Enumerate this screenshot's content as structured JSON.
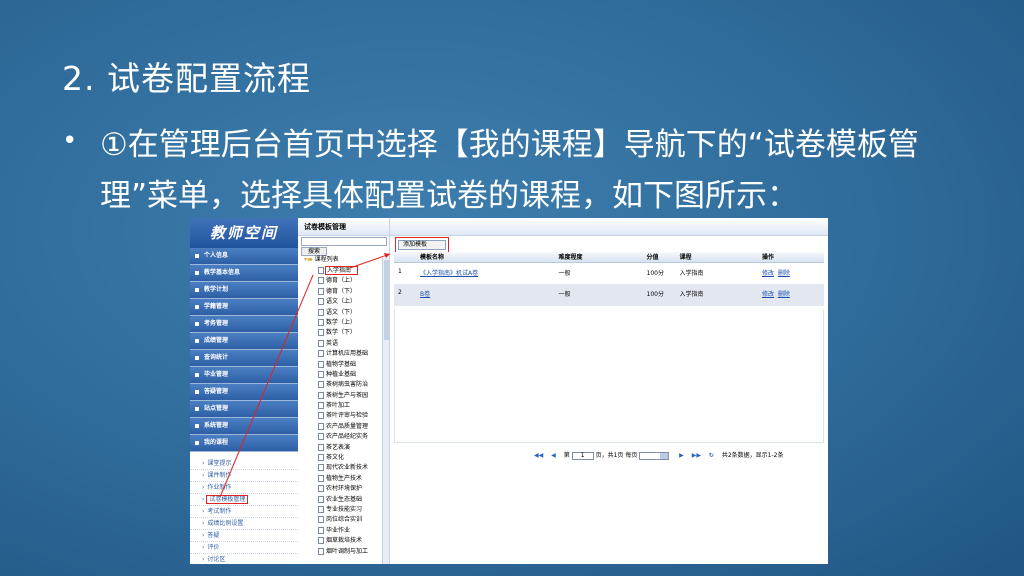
{
  "slide": {
    "title": "2. 试卷配置流程",
    "bullet": "①在管理后台首页中选择【我的课程】导航下的“试卷模板管理”菜单，选择具体配置试卷的课程，如下图所示："
  },
  "app": {
    "logo": "教师空间",
    "menu": [
      "个人信息",
      "教学基本信息",
      "教学计划",
      "学籍管理",
      "考务管理",
      "成绩管理",
      "查询统计",
      "毕业管理",
      "答疑管理",
      "站点管理",
      "系统管理",
      "我的课程"
    ],
    "sub_menu": [
      "课堂提示",
      "课件制作",
      "作业制作",
      "试卷模板管理",
      "考试制作",
      "成绩比例设置",
      "答疑",
      "评价",
      "讨论区"
    ],
    "sub_menu_active": "试卷模板管理",
    "panel_title": "试卷模板管理",
    "search_button": "搜索",
    "tree_root": "课程列表",
    "courses": [
      "入学指南",
      "德育（上）",
      "德育（下）",
      "语文（上）",
      "语文（下）",
      "数学（上）",
      "数学（下）",
      "英语",
      "计算机应用基础",
      "植物学基础",
      "种植业基础",
      "茶树病虫害防治",
      "茶树生产与茶园",
      "茶叶加工",
      "茶叶评审与检验",
      "农产品质量管理",
      "农产品经纪实务",
      "茶艺表演",
      "茶文化",
      "现代农业新技术",
      "植物生产技术",
      "农村环境保护",
      "农业生态基础",
      "专业技能实习",
      "岗位综合实训",
      "毕业作业",
      "烟草栽培技术",
      "烟叶调制与加工"
    ],
    "course_active": "入学指南",
    "add_button": "添加模板",
    "table": {
      "headers": [
        "",
        "模板名称",
        "难度程度",
        "分值",
        "课程",
        "操作"
      ],
      "rows": [
        {
          "no": "1",
          "name": "《入学指南》机试A卷",
          "level": "一般",
          "score": "100分",
          "course": "入学指南",
          "edit": "修改",
          "del": "删除"
        },
        {
          "no": "2",
          "name": "B卷",
          "level": "一般",
          "score": "100分",
          "course": "入学指南",
          "edit": "修改",
          "del": "删除"
        }
      ]
    },
    "pager": {
      "first": "◀◀",
      "prev": "◀",
      "page_label": "第",
      "page_value": "1",
      "page_suffix": "页，共1页",
      "per_page_label": "每页",
      "next": "▶",
      "last": "▶▶",
      "refresh": "↻",
      "summary": "共2条数据，显示1-2条"
    }
  }
}
